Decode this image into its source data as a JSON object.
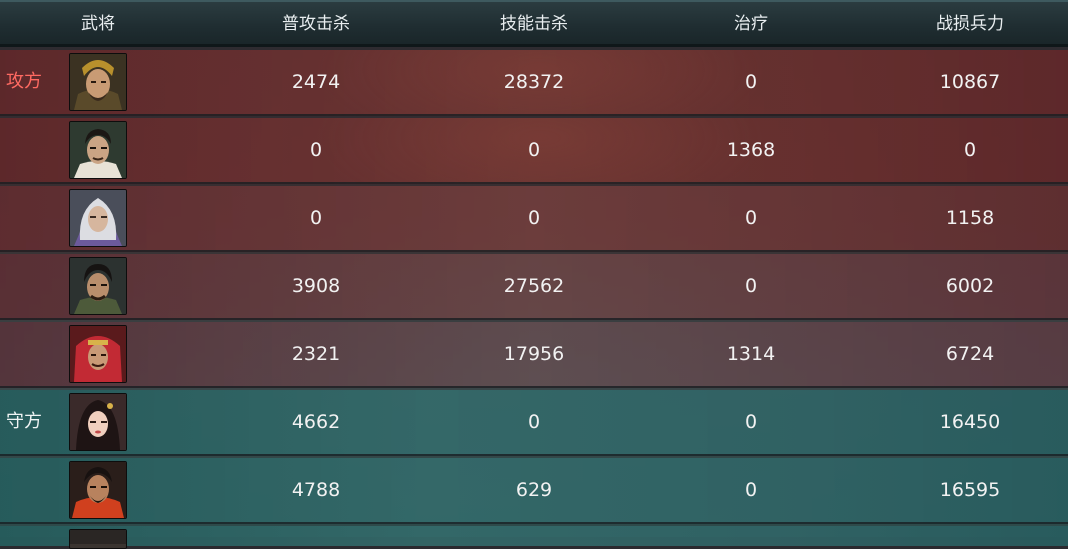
{
  "header": {
    "col_general": "武将",
    "col_normal_kills": "普攻击杀",
    "col_skill_kills": "技能击杀",
    "col_heal": "治疗",
    "col_losses": "战损兵力"
  },
  "rows": [
    {
      "side_label": "攻方",
      "side": "attacker",
      "portrait": "general-portrait-gold-helmet-icon",
      "normal_kills": "2474",
      "skill_kills": "28372",
      "heal": "0",
      "losses": "10867"
    },
    {
      "side_label": "",
      "side": "attacker",
      "portrait": "general-portrait-strategist-icon",
      "normal_kills": "0",
      "skill_kills": "0",
      "heal": "1368",
      "losses": "0"
    },
    {
      "side_label": "",
      "side": "attacker",
      "portrait": "general-portrait-white-hair-icon",
      "normal_kills": "0",
      "skill_kills": "0",
      "heal": "0",
      "losses": "1158"
    },
    {
      "side_label": "",
      "side": "attacker",
      "portrait": "general-portrait-warrior-icon",
      "normal_kills": "3908",
      "skill_kills": "27562",
      "heal": "0",
      "losses": "6002"
    },
    {
      "side_label": "",
      "side": "attacker",
      "portrait": "general-portrait-red-hood-icon",
      "normal_kills": "2321",
      "skill_kills": "17956",
      "heal": "1314",
      "losses": "6724"
    },
    {
      "side_label": "守方",
      "side": "defender",
      "portrait": "general-portrait-lady-icon",
      "normal_kills": "4662",
      "skill_kills": "0",
      "heal": "0",
      "losses": "16450"
    },
    {
      "side_label": "",
      "side": "defender",
      "portrait": "general-portrait-red-armor-icon",
      "normal_kills": "4788",
      "skill_kills": "629",
      "heal": "0",
      "losses": "16595"
    }
  ],
  "colors": {
    "attacker_label": "#ff6a62",
    "attacker_row": "#6e3030",
    "defender_row": "#306464",
    "header_bg": "#1f2d31"
  }
}
